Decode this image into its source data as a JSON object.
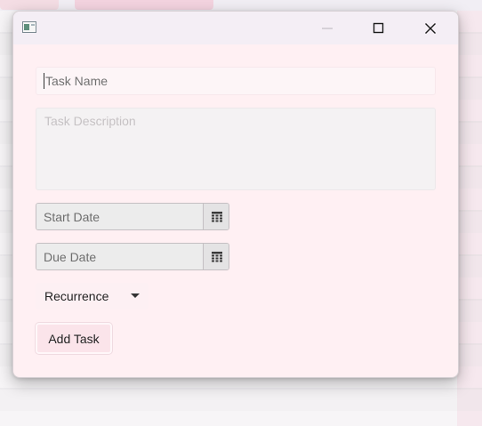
{
  "window": {
    "controls": {
      "minimize_icon": "minimize-icon",
      "maximize_icon": "maximize-icon",
      "close_icon": "close-icon"
    }
  },
  "form": {
    "task_name": {
      "value": "",
      "placeholder": "Task Name"
    },
    "task_description": {
      "value": "",
      "placeholder": "Task Description"
    },
    "start_date": {
      "value": "",
      "placeholder": "Start Date",
      "icon": "calendar-icon"
    },
    "due_date": {
      "value": "",
      "placeholder": "Due Date",
      "icon": "calendar-icon"
    },
    "recurrence": {
      "selected": "Recurrence",
      "icon": "chevron-down-icon"
    },
    "submit_label": "Add Task"
  },
  "colors": {
    "window_bg": "#fff0f3",
    "titlebar_bg": "#f4eef5",
    "button_bg": "#fbe4ea"
  }
}
